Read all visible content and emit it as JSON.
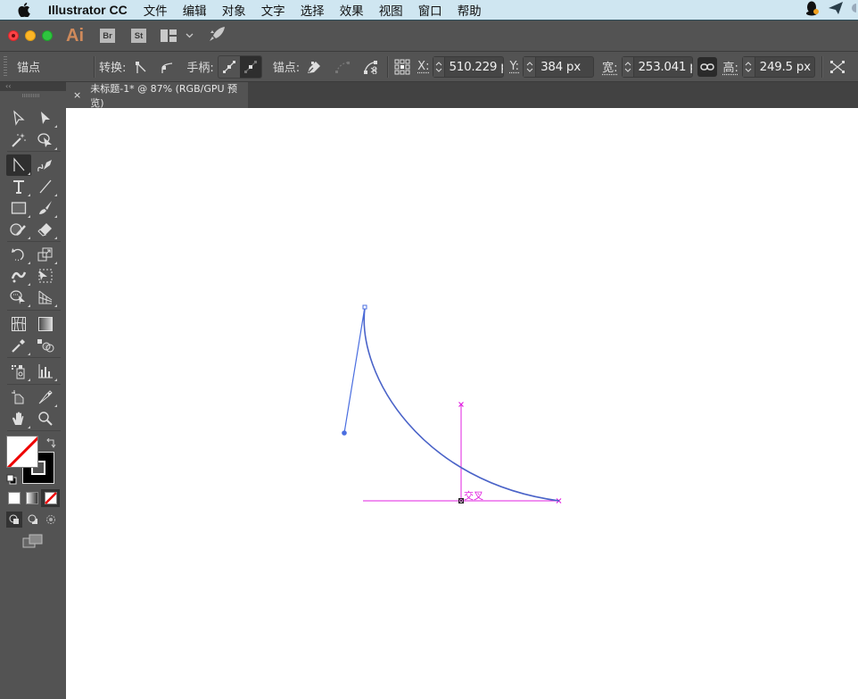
{
  "menubar": {
    "app_name": "Illustrator CC",
    "items": [
      "文件",
      "编辑",
      "对象",
      "文字",
      "选择",
      "效果",
      "视图",
      "窗口",
      "帮助"
    ],
    "status_icons": [
      "qq-icon",
      "send-icon"
    ]
  },
  "titlebar": {
    "app_logo": "Ai",
    "bridge_label": "Br",
    "stock_label": "St"
  },
  "optionbar": {
    "tool_name": "锚点",
    "convert_label": "转换:",
    "handles_label": "手柄:",
    "anchor_label": "锚点:",
    "x_label": "X:",
    "x_value": "510.229 p",
    "y_label": "Y:",
    "y_value": "384 px",
    "w_label": "宽:",
    "w_value": "253.041 p",
    "h_label": "高:",
    "h_value": "249.5 px"
  },
  "panel": {
    "collapse_label": "‹‹"
  },
  "document": {
    "tab_close": "×",
    "tab_title": "未标题-1* @ 87% (RGB/GPU 预览)"
  },
  "canvas": {
    "smart_guide_label": "交叉",
    "path_color": "#4a63c8",
    "guide_color": "#e020e0"
  },
  "colors": {
    "fill": "none",
    "stroke": "#000000"
  }
}
